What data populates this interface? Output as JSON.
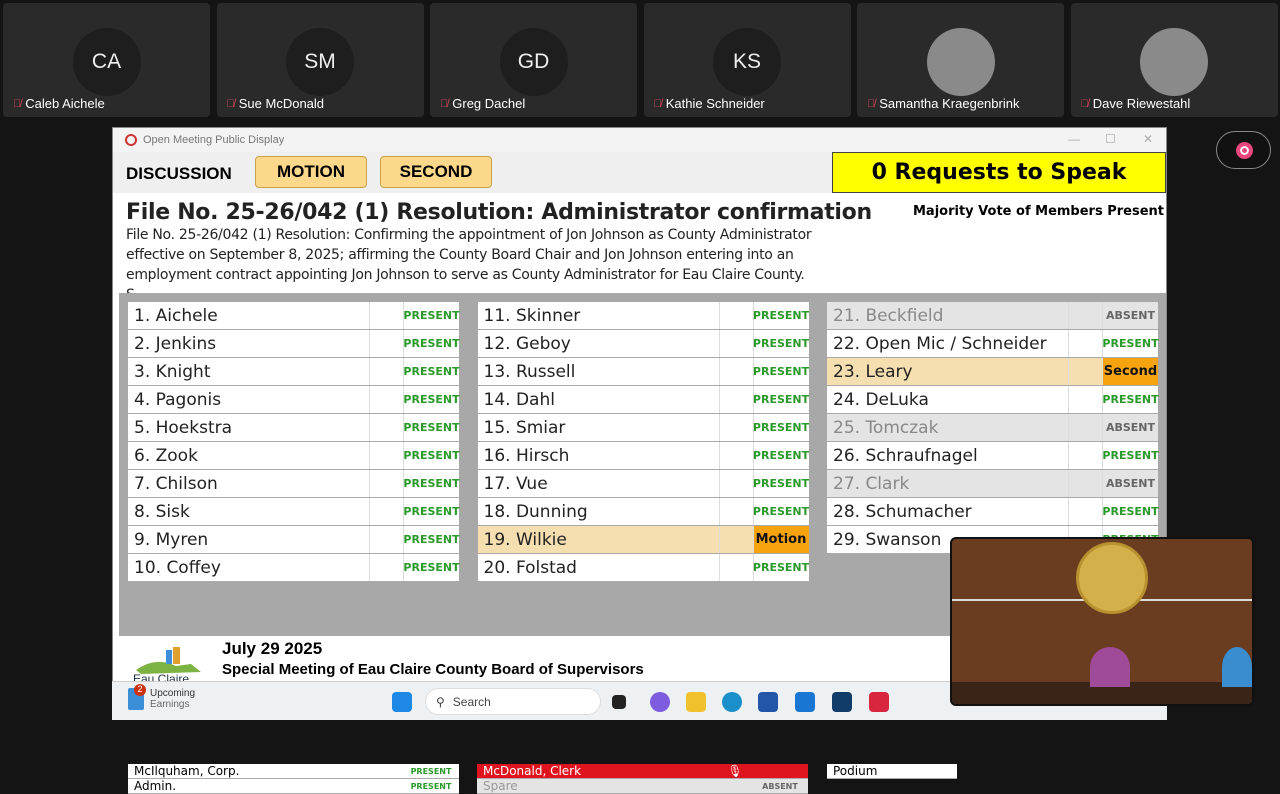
{
  "participants": [
    {
      "initials": "CA",
      "name": "Caleb Aichele"
    },
    {
      "initials": "SM",
      "name": "Sue McDonald"
    },
    {
      "initials": "GD",
      "name": "Greg Dachel"
    },
    {
      "initials": "KS",
      "name": "Kathie Schneider"
    },
    {
      "initials": "",
      "name": "Samantha Kraegenbrink"
    },
    {
      "initials": "",
      "name": "Dave Riewestahl"
    }
  ],
  "window": {
    "title": "Open Meeting Public Display"
  },
  "header": {
    "discussion": "DISCUSSION",
    "motion": "MOTION",
    "second": "SECOND",
    "requests": "0 Requests to Speak"
  },
  "file": {
    "title": "File No. 25-26/042 (1) Resolution: Administrator confirmation",
    "description": "File No. 25-26/042 (1) Resolution: Confirming the appointment of Jon Johnson as County Administrator effective on September 8, 2025; affirming the County Board Chair and Jon Johnson entering into an employment contract appointing Jon Johnson to serve as County Administrator for Eau Claire County. S...",
    "vote": "Majority Vote of Members Present"
  },
  "members": [
    [
      {
        "name": "1. Aichele",
        "status": "PRESENT"
      },
      {
        "name": "2. Jenkins",
        "status": "PRESENT"
      },
      {
        "name": "3. Knight",
        "status": "PRESENT"
      },
      {
        "name": "4. Pagonis",
        "status": "PRESENT"
      },
      {
        "name": "5. Hoekstra",
        "status": "PRESENT"
      },
      {
        "name": "6. Zook",
        "status": "PRESENT"
      },
      {
        "name": "7. Chilson",
        "status": "PRESENT"
      },
      {
        "name": "8. Sisk",
        "status": "PRESENT"
      },
      {
        "name": "9. Myren",
        "status": "PRESENT"
      },
      {
        "name": "10. Coffey",
        "status": "PRESENT"
      }
    ],
    [
      {
        "name": "11. Skinner",
        "status": "PRESENT"
      },
      {
        "name": "12. Geboy",
        "status": "PRESENT"
      },
      {
        "name": "13. Russell",
        "status": "PRESENT"
      },
      {
        "name": "14. Dahl",
        "status": "PRESENT"
      },
      {
        "name": "15. Smiar",
        "status": "PRESENT"
      },
      {
        "name": "16. Hirsch",
        "status": "PRESENT"
      },
      {
        "name": "17. Vue",
        "status": "PRESENT"
      },
      {
        "name": "18. Dunning",
        "status": "PRESENT"
      },
      {
        "name": "19. Wilkie",
        "status": "Motion"
      },
      {
        "name": "20. Folstad",
        "status": "PRESENT"
      }
    ],
    [
      {
        "name": "21. Beckfield",
        "status": "ABSENT"
      },
      {
        "name": "22. Open Mic / Schneider",
        "status": "PRESENT"
      },
      {
        "name": "23. Leary",
        "status": "Second"
      },
      {
        "name": "24. DeLuka",
        "status": "PRESENT"
      },
      {
        "name": "25. Tomczak",
        "status": "ABSENT"
      },
      {
        "name": "26. Schraufnagel",
        "status": "PRESENT"
      },
      {
        "name": "27. Clark",
        "status": "ABSENT"
      },
      {
        "name": "28. Schumacher",
        "status": "PRESENT"
      },
      {
        "name": "29. Swanson",
        "status": "PRESENT"
      }
    ]
  ],
  "staff": [
    {
      "name": "McIlquham, Corp.",
      "status": "PRESENT"
    },
    {
      "name": "Admin.",
      "status": "PRESENT"
    },
    {
      "name": "McDonald, Clerk",
      "status": ""
    },
    {
      "name": "Spare",
      "status": "ABSENT"
    },
    {
      "name": "Podium",
      "status": ""
    }
  ],
  "footer": {
    "logo_text": "Eau Claire",
    "date": "July 29 2025",
    "meeting": "Special Meeting of Eau Claire County Board of Supervisors"
  },
  "taskbar": {
    "widget_badge": "2",
    "widget_line1": "Upcoming",
    "widget_line2": "Earnings",
    "search": "Search"
  }
}
